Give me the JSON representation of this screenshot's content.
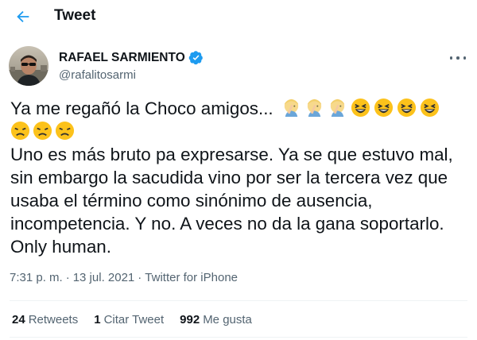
{
  "header": {
    "title": "Tweet",
    "back_icon": "arrow-left-icon",
    "accent_color": "#1d9bf0"
  },
  "author": {
    "name": "RAFAEL SARMIENTO",
    "handle": "@rafalitosarmi",
    "verified_icon": "verified-badge-icon",
    "more_icon": "more-horizontal-icon"
  },
  "tweet": {
    "line1": "Ya me regañó la Choco amigos...",
    "line1_emojis": [
      "facepalm-emoji",
      "facepalm-emoji",
      "facepalm-emoji",
      "laughing-emoji",
      "laughing-emoji",
      "laughing-emoji",
      "laughing-emoji"
    ],
    "line2_emojis": [
      "disappointed-emoji",
      "disappointed-emoji",
      "disappointed-emoji"
    ],
    "text": "Uno es más bruto pa expresarse. Ya se que estuvo mal, sin embargo la sacudida vino por ser la tercera vez que usaba el término como sinónimo de ausencia, incompetencia. Y no. A veces no da la gana soportarlo. Only human."
  },
  "meta": {
    "time": "7:31 p. m.",
    "separator": "·",
    "date": "13 jul. 2021",
    "source": "Twitter for iPhone"
  },
  "stats": {
    "retweets_count": "24",
    "retweets_label": "Retweets",
    "quotes_count": "1",
    "quotes_label": "Citar Tweet",
    "likes_count": "992",
    "likes_label": "Me gusta"
  }
}
